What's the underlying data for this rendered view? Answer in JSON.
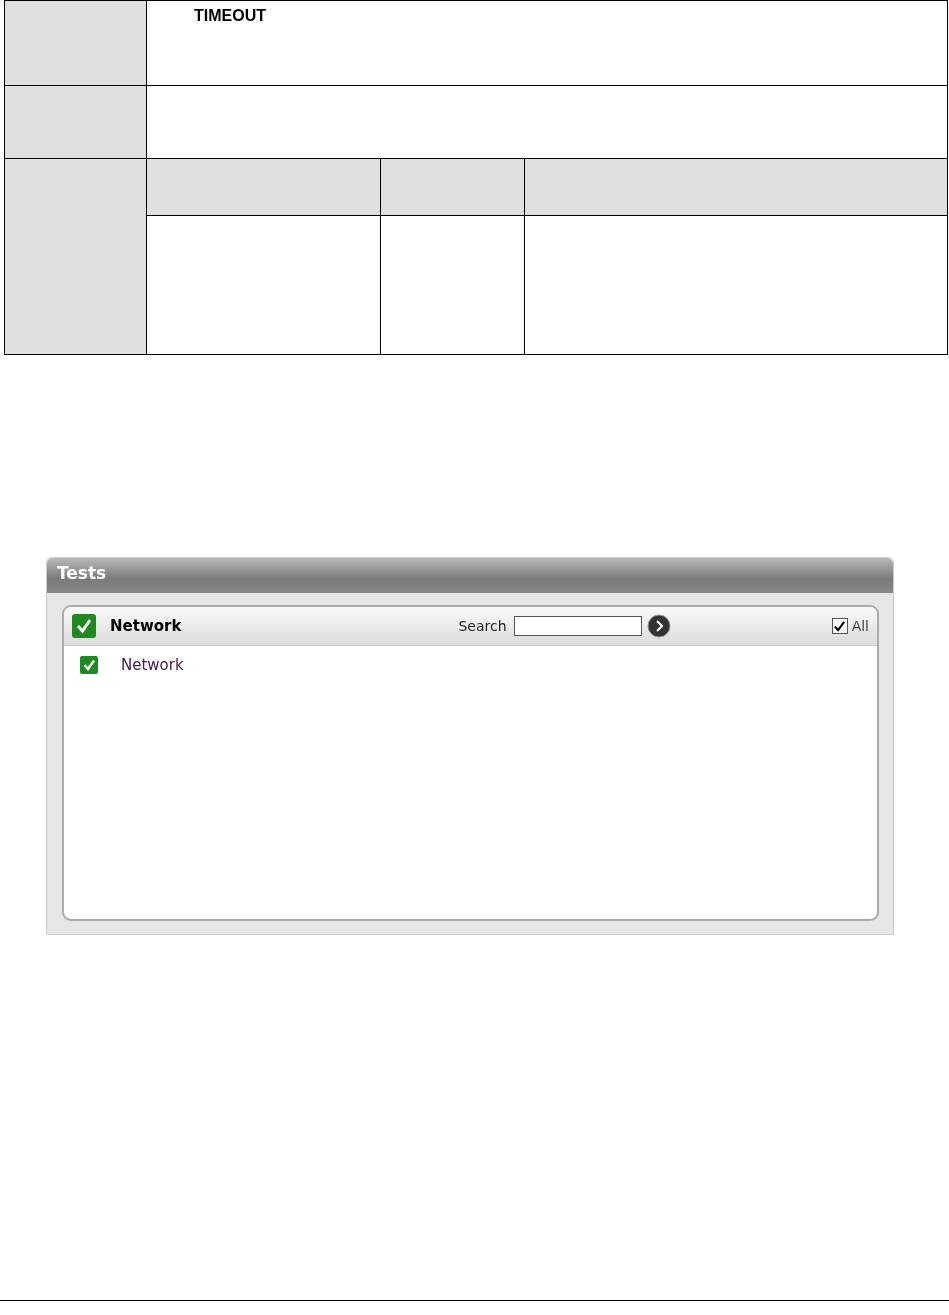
{
  "table": {
    "first_row_text": "TIMEOUT"
  },
  "panel": {
    "title": "Tests",
    "group": {
      "label": "Network",
      "checked": true
    },
    "search": {
      "label": "Search"
    },
    "all": {
      "label": "All",
      "checked": true
    },
    "items": [
      {
        "label": "Network",
        "checked": true
      }
    ]
  }
}
